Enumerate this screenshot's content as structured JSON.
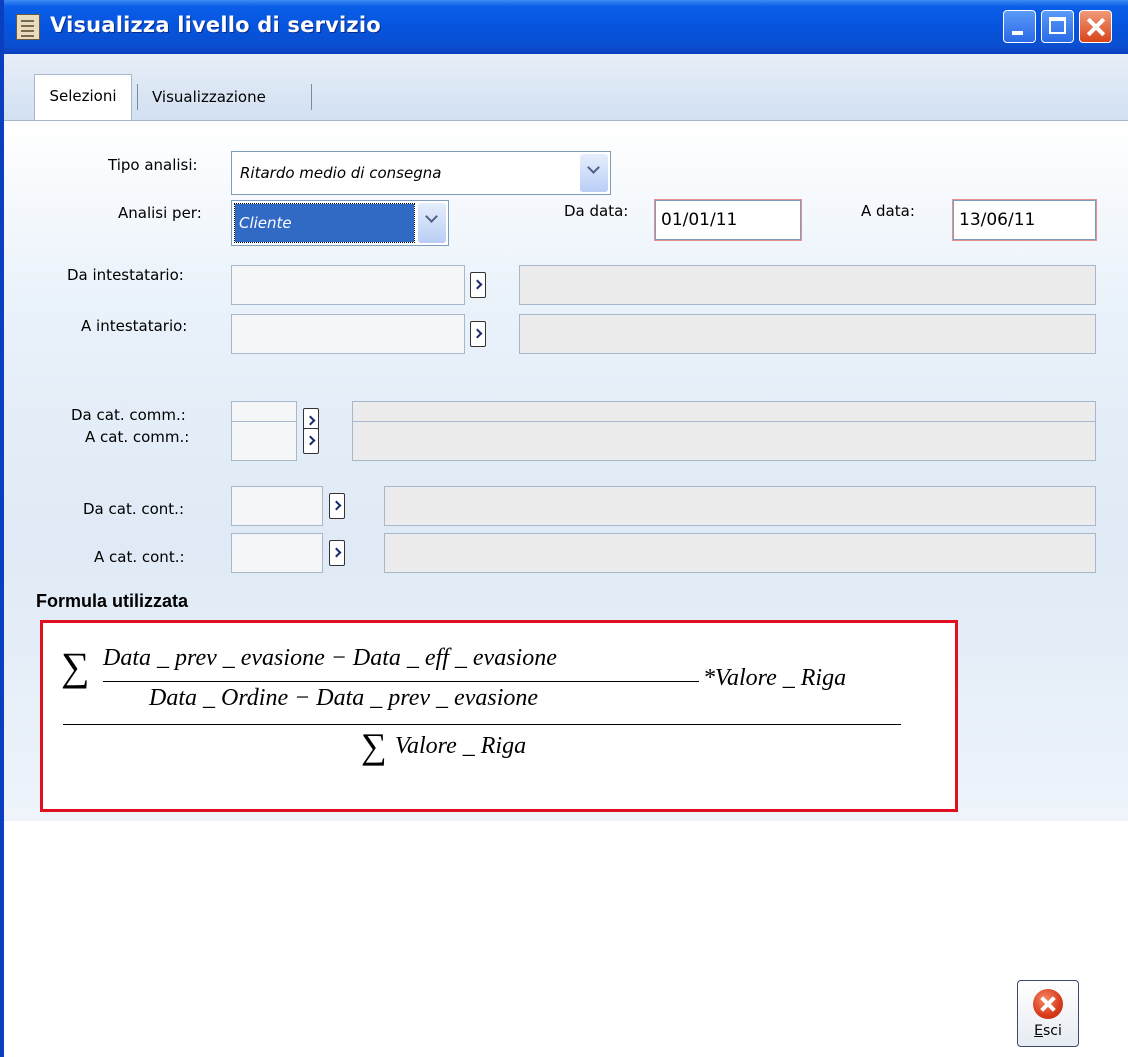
{
  "window": {
    "title": "Visualizza livello di servizio"
  },
  "tabs": [
    {
      "label": "Selezioni",
      "active": true
    },
    {
      "label": "Visualizzazione",
      "active": false
    }
  ],
  "form": {
    "tipo_analisi": {
      "label": "Tipo analisi:",
      "value": "Ritardo medio di consegna"
    },
    "analisi_per": {
      "label": "Analisi per:",
      "value": "Cliente"
    },
    "da_data": {
      "label": "Da data:",
      "value": "01/01/11"
    },
    "a_data": {
      "label": "A data:",
      "value": "13/06/11"
    },
    "da_intestatario": {
      "label": "Da intestatario:"
    },
    "a_intestatario": {
      "label": "A intestatario:"
    },
    "da_cat_comm": {
      "label": "Da cat. comm.:"
    },
    "a_cat_comm": {
      "label": "A cat. comm.:"
    },
    "da_cat_cont": {
      "label": "Da cat. cont.:"
    },
    "a_cat_cont": {
      "label": "A cat. cont.:"
    }
  },
  "formula": {
    "title": "Formula utilizzata",
    "sigma": "∑",
    "numerator": "Data _ prev _ evasione − Data _ eff _ evasione",
    "denominator_inner": "Data _ Ordine − Data _ prev _ evasione",
    "multiplier": "*Valore _ Riga",
    "denominator": "Valore _ Riga"
  },
  "buttons": {
    "esci": {
      "accel": "E",
      "rest": "sci"
    }
  },
  "colors": {
    "titlebar": "#0654de",
    "formula_border": "#e01020",
    "selection": "#316ac5"
  },
  "icons": [
    "app-icon",
    "minimize-icon",
    "maximize-icon",
    "close-icon",
    "dropdown-arrow-icon",
    "zoom-arrow-icon",
    "exit-icon"
  ]
}
